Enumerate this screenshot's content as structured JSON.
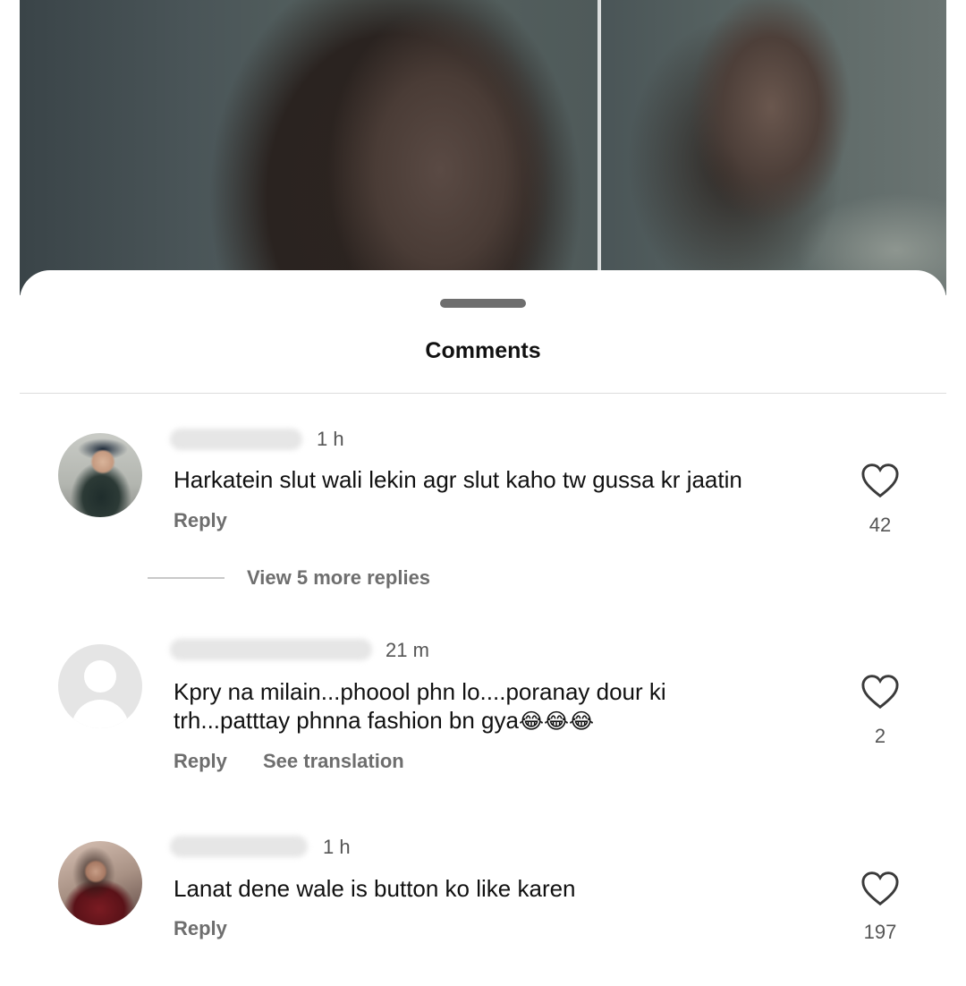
{
  "sheet": {
    "title": "Comments"
  },
  "comments": [
    {
      "time": "1 h",
      "text": "Harkatein slut wali lekin agr slut kaho tw gussa kr jaatin",
      "reply_label": "Reply",
      "likes": "42",
      "view_replies": "View 5 more replies"
    },
    {
      "time": "21 m",
      "text_line1": "Kpry na milain...phoool phn lo....poranay dour ki",
      "text_line2": "trh...patttay phnna fashion bn gya",
      "emojis": "😂😂😂",
      "reply_label": "Reply",
      "see_translation": "See translation",
      "likes": "2"
    },
    {
      "time": "1 h",
      "text": "Lanat dene wale is button ko like karen",
      "reply_label": "Reply",
      "likes": "197"
    }
  ],
  "icons": {
    "like": "heart-outline-icon",
    "avatar_placeholder": "person-silhouette-icon"
  },
  "colors": {
    "sheet_bg": "#ffffff",
    "secondary_text": "#6e6e6e",
    "dim_overlay": "#3a4448"
  }
}
